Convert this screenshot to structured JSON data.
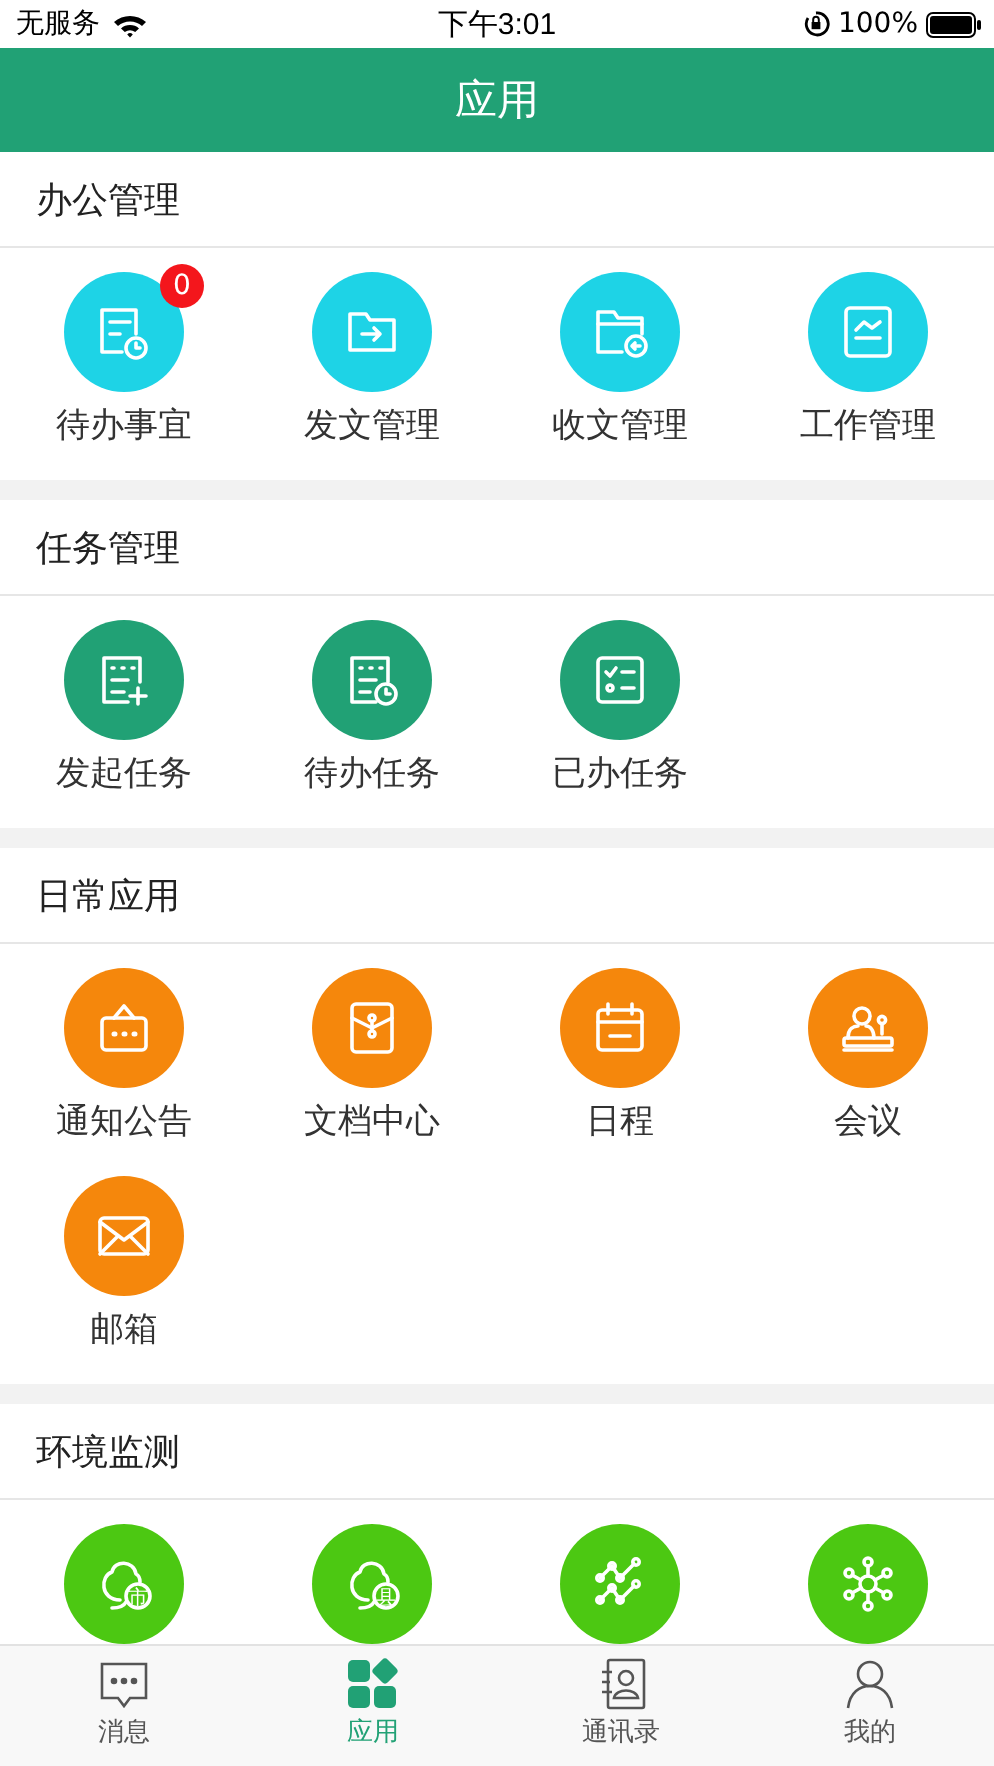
{
  "status_bar": {
    "carrier": "无服务",
    "time": "下午3:01",
    "battery": "100%"
  },
  "header": {
    "title": "应用"
  },
  "sections": [
    {
      "title": "办公管理",
      "color": "#1ed3e6",
      "items": [
        {
          "label": "待办事宜",
          "badge": "0"
        },
        {
          "label": "发文管理"
        },
        {
          "label": "收文管理"
        },
        {
          "label": "工作管理"
        }
      ]
    },
    {
      "title": "任务管理",
      "color": "#21a175",
      "items": [
        {
          "label": "发起任务"
        },
        {
          "label": "待办任务"
        },
        {
          "label": "已办任务"
        }
      ]
    },
    {
      "title": "日常应用",
      "color": "#f5870c",
      "items": [
        {
          "label": "通知公告"
        },
        {
          "label": "文档中心"
        },
        {
          "label": "日程"
        },
        {
          "label": "会议"
        },
        {
          "label": "邮箱"
        }
      ]
    },
    {
      "title": "环境监测",
      "color": "#4cc812",
      "items": [
        {
          "kind": "cloud",
          "icon_text": "市"
        },
        {
          "kind": "cloud",
          "icon_text": "县"
        },
        {
          "kind": "trend"
        },
        {
          "kind": "network"
        }
      ]
    }
  ],
  "tab_bar": [
    {
      "label": "消息",
      "selected": false
    },
    {
      "label": "应用",
      "selected": true
    },
    {
      "label": "通讯录",
      "selected": false
    },
    {
      "label": "我的",
      "selected": false
    }
  ]
}
